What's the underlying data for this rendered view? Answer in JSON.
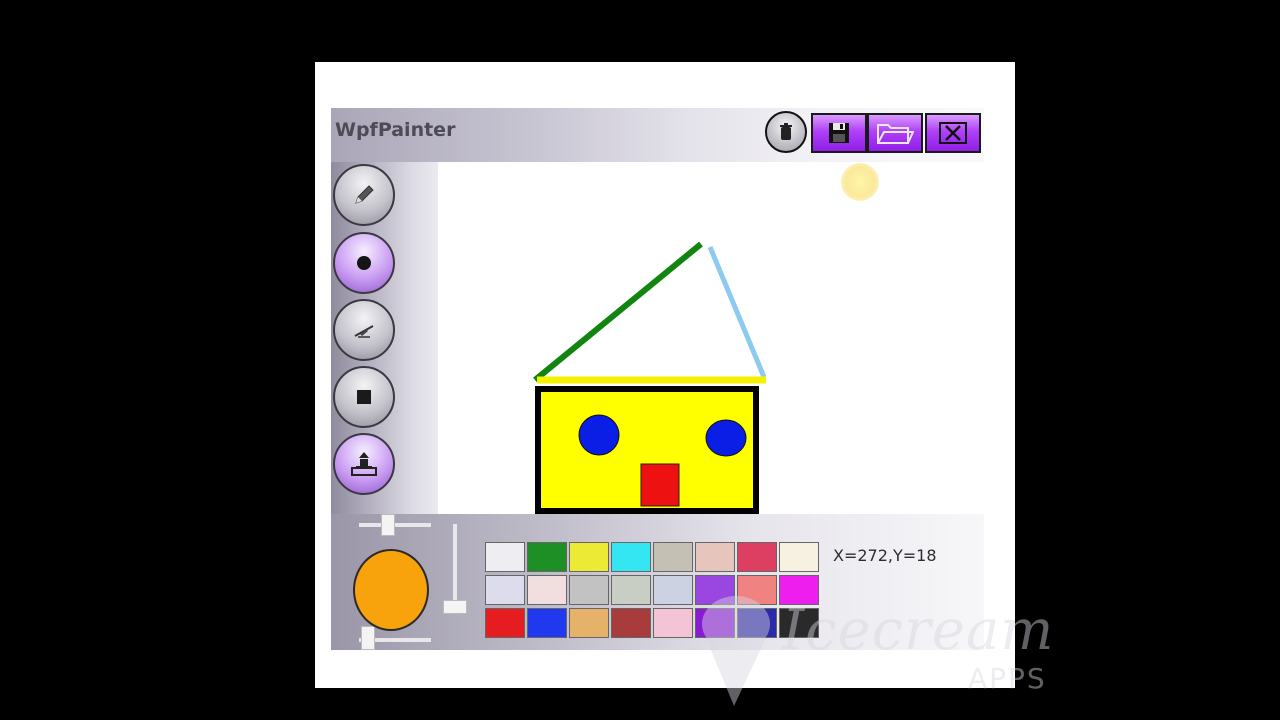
{
  "app": {
    "title": "WpfPainter"
  },
  "toolbar_top": {
    "buttons": [
      {
        "name": "clear-button",
        "icon": "trash-icon"
      },
      {
        "name": "save-button",
        "icon": "floppy-disk-icon"
      },
      {
        "name": "open-button",
        "icon": "folder-open-icon"
      },
      {
        "name": "close-button",
        "icon": "close-x-icon"
      }
    ]
  },
  "tools": [
    {
      "name": "pencil-tool",
      "icon": "pencil-icon",
      "active": false
    },
    {
      "name": "ellipse-tool",
      "icon": "circle-dot-icon",
      "active": true
    },
    {
      "name": "line-tool",
      "icon": "line-brush-icon",
      "active": false
    },
    {
      "name": "rectangle-tool",
      "icon": "square-icon",
      "active": false
    },
    {
      "name": "fill-tool",
      "icon": "paint-bucket-icon",
      "active": true
    }
  ],
  "brush": {
    "color": "#f8a20c"
  },
  "palette": [
    "#eeeef2",
    "#1d8f25",
    "#ecea34",
    "#33e6f1",
    "#c4c0b4",
    "#e6c6bc",
    "#dd3f62",
    "#f6f1e0",
    "#dcdcec",
    "#f1dede",
    "#c2c2c2",
    "#c8cec4",
    "#ccd2e2",
    "#9a46e0",
    "#f08282",
    "#ee1fee",
    "#e51c20",
    "#2038ee",
    "#e6b26a",
    "#a83b3b",
    "#f3c4d6",
    "#8a1ad6",
    "#2a2aa6",
    "#2a2a2a"
  ],
  "status": {
    "coords": "X=272,Y=18"
  },
  "watermark": {
    "script_text": "Icecream",
    "sub_text": "APPS"
  },
  "colors": {
    "accent_purple": "#a12ef0",
    "roof_left": "#11850f",
    "roof_right": "#8ccaf0",
    "roof_base": "#f5f000",
    "house_fill": "#ffff00",
    "house_border": "#000000",
    "eyes": "#0a1ee6",
    "door": "#ee1111"
  }
}
